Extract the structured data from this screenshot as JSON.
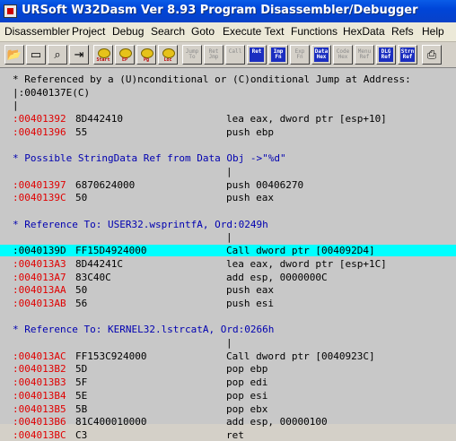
{
  "window": {
    "title": "URSoft W32Dasm Ver 8.93 Program Disassembler/Debugger"
  },
  "menu": [
    "Disassembler",
    "Project",
    "Debug",
    "Search",
    "Goto",
    "Execute Text",
    "Functions",
    "HexData",
    "Refs",
    "Help"
  ],
  "toolbar": [
    {
      "name": "open-disassembly-file-button",
      "label": "",
      "icon": "folder-icon",
      "style": "icon"
    },
    {
      "name": "save-disassembly-button",
      "label": "",
      "icon": "floppy-icon",
      "style": "icon"
    },
    {
      "name": "find-text-button",
      "label": "",
      "icon": "find-icon",
      "style": "icon"
    },
    {
      "name": "copy-lines-button",
      "label": "",
      "icon": "copy-icon",
      "style": "icon"
    },
    {
      "name": "goto-code-start-button",
      "label": "Start",
      "icon": "code-start-icon",
      "style": "gear"
    },
    {
      "name": "goto-program-entry-button",
      "label": "EP",
      "icon": "entry-point-icon",
      "style": "gear"
    },
    {
      "name": "goto-page-button",
      "label": "Pg",
      "icon": "goto-page-icon",
      "style": "gear"
    },
    {
      "name": "goto-code-location-button",
      "label": "Loc",
      "icon": "code-location-icon",
      "style": "gear"
    },
    {
      "name": "execute-jump-button",
      "label": "Jump To",
      "icon": "jump-icon",
      "style": "gray"
    },
    {
      "name": "return-from-jump-button",
      "label": "Ret Jmp",
      "icon": "return-jump-icon",
      "style": "gray"
    },
    {
      "name": "execute-call-button",
      "label": "Call",
      "icon": "call-icon",
      "style": "gray"
    },
    {
      "name": "return-from-call-button",
      "label": "Ret",
      "icon": "return-icon",
      "style": "blue"
    },
    {
      "name": "imported-functions-button",
      "label": "Imp Fn",
      "icon": "import-icon",
      "style": "blue"
    },
    {
      "name": "exported-functions-button",
      "label": "Exp Fn",
      "icon": "export-icon",
      "style": "gray"
    },
    {
      "name": "data-hexdata-button",
      "label": "Data Hex",
      "icon": "hexdata-icon",
      "style": "blue"
    },
    {
      "name": "code-hexdata-button",
      "label": "Code Hex",
      "icon": "code-hex-icon",
      "style": "gray"
    },
    {
      "name": "menu-refs-button",
      "label": "Menu Ref",
      "icon": "menu-ref-icon",
      "style": "gray"
    },
    {
      "name": "dialog-refs-button",
      "label": "DLG Ref",
      "icon": "dialog-ref-icon",
      "style": "blue"
    },
    {
      "name": "string-data-refs-button",
      "label": "Strn Ref",
      "icon": "string-ref-icon",
      "style": "blue"
    },
    {
      "name": "print-button",
      "label": "",
      "icon": "printer-icon",
      "style": "icon"
    }
  ],
  "listing": [
    {
      "kind": "comment",
      "text": "* Referenced by a (U)nconditional or (C)onditional Jump at Address:"
    },
    {
      "kind": "plain",
      "text": "|:0040137E(C)"
    },
    {
      "kind": "plain",
      "text": "|"
    },
    {
      "kind": "code",
      "addr": ":00401392",
      "hex": "8D442410",
      "ins": "lea eax, dword ptr [esp+10]"
    },
    {
      "kind": "code",
      "addr": ":00401396",
      "hex": "55",
      "ins": "push ebp"
    },
    {
      "kind": "blank"
    },
    {
      "kind": "ref",
      "text": "* Possible StringData Ref from Data Obj ->\"%d\""
    },
    {
      "kind": "bar",
      "text": "|"
    },
    {
      "kind": "code",
      "addr": ":00401397",
      "hex": "6870624000",
      "ins": "push 00406270"
    },
    {
      "kind": "code",
      "addr": ":0040139C",
      "hex": "50",
      "ins": "push eax"
    },
    {
      "kind": "blank"
    },
    {
      "kind": "ref",
      "text": "* Reference To: USER32.wsprintfA, Ord:0249h"
    },
    {
      "kind": "bar",
      "text": "|"
    },
    {
      "kind": "code",
      "hl": true,
      "addr": ":0040139D",
      "hex": "FF15D4924000",
      "ins": "Call dword ptr [004092D4]"
    },
    {
      "kind": "code",
      "addr": ":004013A3",
      "hex": "8D44241C",
      "ins": "lea eax, dword ptr [esp+1C]"
    },
    {
      "kind": "code",
      "addr": ":004013A7",
      "hex": "83C40C",
      "ins": "add esp, 0000000C"
    },
    {
      "kind": "code",
      "addr": ":004013AA",
      "hex": "50",
      "ins": "push eax"
    },
    {
      "kind": "code",
      "addr": ":004013AB",
      "hex": "56",
      "ins": "push esi"
    },
    {
      "kind": "blank"
    },
    {
      "kind": "ref",
      "text": "* Reference To: KERNEL32.lstrcatA, Ord:0266h"
    },
    {
      "kind": "bar",
      "text": "|"
    },
    {
      "kind": "code",
      "addr": ":004013AC",
      "hex": "FF153C924000",
      "ins": "Call dword ptr [0040923C]"
    },
    {
      "kind": "code",
      "addr": ":004013B2",
      "hex": "5D",
      "ins": "pop ebp"
    },
    {
      "kind": "code",
      "addr": ":004013B3",
      "hex": "5F",
      "ins": "pop edi"
    },
    {
      "kind": "code",
      "addr": ":004013B4",
      "hex": "5E",
      "ins": "pop esi"
    },
    {
      "kind": "code",
      "addr": ":004013B5",
      "hex": "5B",
      "ins": "pop ebx"
    },
    {
      "kind": "code",
      "addr": ":004013B6",
      "hex": "81C400010000",
      "ins": "add esp, 00000100"
    },
    {
      "kind": "code",
      "addr": ":004013BC",
      "hex": "C3",
      "ins": "ret"
    }
  ]
}
